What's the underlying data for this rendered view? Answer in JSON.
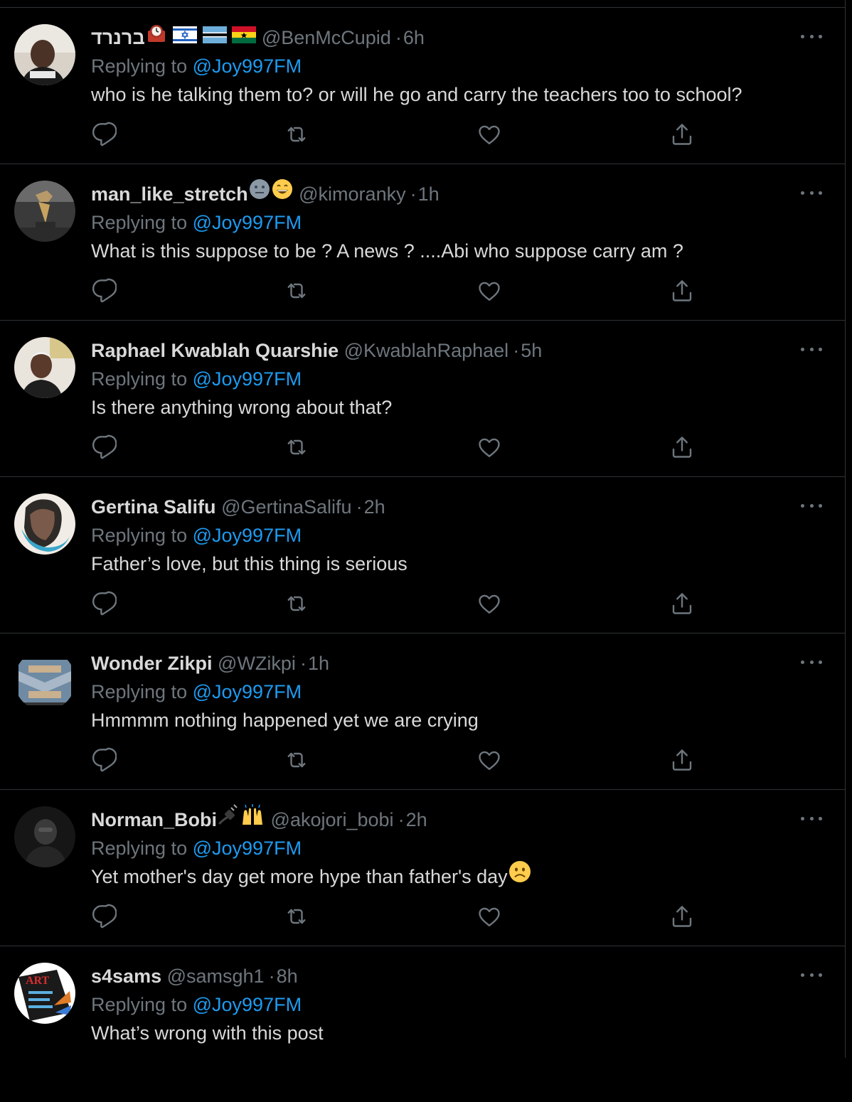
{
  "colors": {
    "background": "#000000",
    "divider": "#2f3336",
    "text_primary": "#d9d9d9",
    "text_secondary": "#6e767d",
    "link": "#1d9bf0"
  },
  "replying_label": "Replying to",
  "tweets": [
    {
      "name": "ברנרד",
      "name_emojis": [
        "mantelpiece-clock-emoji",
        "flag-israel-emoji",
        "flag-botswana-emoji",
        "flag-ghana-emoji"
      ],
      "handle": "@BenMcCupid",
      "time": "6h",
      "mention": "@Joy997FM",
      "text": "who is he talking them to? or will he go and carry the teachers too to school?"
    },
    {
      "name": "man_like_stretch",
      "name_emojis": [
        "neutral-face-emoji",
        "grinning-face-emoji"
      ],
      "handle": "@kimoranky",
      "time": "1h",
      "mention": "@Joy997FM",
      "text": "What is this suppose to be ? A news ? ....Abi who suppose carry am ?"
    },
    {
      "name": "Raphael Kwablah Quarshie",
      "handle": "@KwablahRaphael",
      "time": "5h",
      "mention": "@Joy997FM",
      "text": "Is there anything wrong about that?"
    },
    {
      "name": "Gertina Salifu",
      "handle": "@GertinaSalifu",
      "time": "2h",
      "mention": "@Joy997FM",
      "text": "Father’s love, but this thing is serious"
    },
    {
      "name": "Wonder Zikpi",
      "handle": "@WZikpi",
      "time": "1h",
      "mention": "@Joy997FM",
      "text": "Hmmmm nothing happened yet we are crying"
    },
    {
      "name": "Norman_Bobi",
      "name_emojis": [
        "electric-plug-emoji",
        "raising-hands-emoji"
      ],
      "handle": "@akojori_bobi",
      "time": "2h",
      "mention": "@Joy997FM",
      "text": "Yet mother's day get more hype than father's day",
      "text_emoji": "slightly-frowning-face-emoji"
    },
    {
      "name": "s4sams",
      "handle": "@samsgh1",
      "time": "8h",
      "mention": "@Joy997FM",
      "text": "What’s wrong with this post",
      "avatar_text": "ART"
    }
  ]
}
